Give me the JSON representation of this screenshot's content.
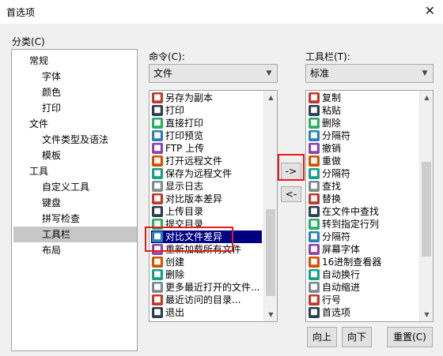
{
  "window": {
    "title": "首选项",
    "close_glyph": "✕"
  },
  "category": {
    "label": "分类(C)",
    "items": [
      {
        "label": "常规",
        "indent": 0
      },
      {
        "label": "字体",
        "indent": 1
      },
      {
        "label": "颜色",
        "indent": 1
      },
      {
        "label": "打印",
        "indent": 1
      },
      {
        "label": "文件",
        "indent": 0
      },
      {
        "label": "文件类型及语法",
        "indent": 1
      },
      {
        "label": "模板",
        "indent": 1
      },
      {
        "label": "工具",
        "indent": 0
      },
      {
        "label": "自定义工具",
        "indent": 1
      },
      {
        "label": "键盘",
        "indent": 1
      },
      {
        "label": "拼写检查",
        "indent": 1
      },
      {
        "label": "工具栏",
        "indent": 1,
        "selected": true
      },
      {
        "label": "布局",
        "indent": 1
      }
    ]
  },
  "commands": {
    "label": "命令(C):",
    "combo_value": "文件",
    "items": [
      {
        "label": "另存为副本",
        "icon": "save-copy-icon"
      },
      {
        "label": "打印",
        "icon": "print-icon"
      },
      {
        "label": "直接打印",
        "icon": "direct-print-icon"
      },
      {
        "label": "打印预览",
        "icon": "print-preview-icon"
      },
      {
        "label": "FTP 上传",
        "icon": "ftp-upload-icon"
      },
      {
        "label": "打开远程文件",
        "icon": "open-remote-icon"
      },
      {
        "label": "保存为远程文件",
        "icon": "save-remote-icon"
      },
      {
        "label": "显示日志",
        "icon": "show-log-icon"
      },
      {
        "label": "对比版本差异",
        "icon": "compare-version-icon"
      },
      {
        "label": "上传目录",
        "icon": "upload-dir-icon"
      },
      {
        "label": "提交目录",
        "icon": "commit-dir-icon"
      },
      {
        "label": "对比文件差异",
        "icon": "compare-file-icon",
        "selected": true
      },
      {
        "label": "重新加载所有文件",
        "icon": "reload-all-icon"
      },
      {
        "label": "创建",
        "icon": "create-icon"
      },
      {
        "label": "删除",
        "icon": "delete-icon"
      },
      {
        "label": "更多最近打开的文件...",
        "icon": "recent-files-icon"
      },
      {
        "label": "最近访问的目录...",
        "icon": "recent-dirs-icon"
      },
      {
        "label": "退出",
        "icon": "exit-icon"
      }
    ]
  },
  "toolbar": {
    "label": "工具栏(T):",
    "combo_value": "标准",
    "items": [
      {
        "label": "复制",
        "icon": "copy-icon"
      },
      {
        "label": "粘贴",
        "icon": "paste-icon"
      },
      {
        "label": "删除",
        "icon": "delete-icon"
      },
      {
        "label": "分隔符",
        "icon": "separator-icon"
      },
      {
        "label": "撤销",
        "icon": "undo-icon"
      },
      {
        "label": "重做",
        "icon": "redo-icon"
      },
      {
        "label": "分隔符",
        "icon": "separator-icon"
      },
      {
        "label": "查找",
        "icon": "find-icon"
      },
      {
        "label": "替换",
        "icon": "replace-icon"
      },
      {
        "label": "在文件中查找",
        "icon": "find-in-files-icon"
      },
      {
        "label": "转到指定行列",
        "icon": "goto-line-icon"
      },
      {
        "label": "分隔符",
        "icon": "separator-icon"
      },
      {
        "label": "屏幕字体",
        "icon": "screen-font-icon"
      },
      {
        "label": "16进制查看器",
        "icon": "hex-viewer-icon"
      },
      {
        "label": "自动换行",
        "icon": "word-wrap-icon"
      },
      {
        "label": "自动缩进",
        "icon": "auto-indent-icon"
      },
      {
        "label": "行号",
        "icon": "line-number-icon"
      },
      {
        "label": "首选项",
        "icon": "preferences-icon"
      }
    ]
  },
  "buttons": {
    "add": "->",
    "remove": "<-",
    "up": "向上",
    "down": "向下",
    "reset": "重置(C)"
  },
  "colors": {
    "selection": "#000080",
    "highlight_box": "#e21b1b",
    "category_selection": "#c7c7c7"
  }
}
